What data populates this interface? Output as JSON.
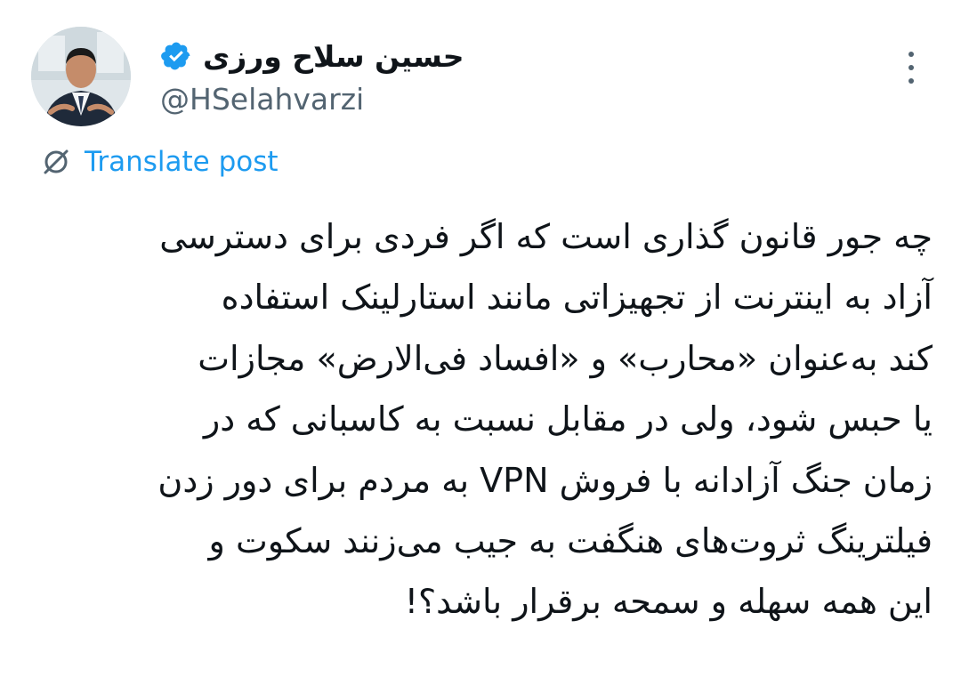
{
  "author": {
    "display_name": "حسین سلاح ورزی",
    "handle": "@HSelahvarzi",
    "verified": true,
    "avatar_icon": "profile-photo-man-in-suit"
  },
  "actions": {
    "more_icon": "more-vertical-icon",
    "translate_label": "Translate post",
    "translate_icon": "translate-globe-icon"
  },
  "post": {
    "lines": [
      "چه جور قانون گذاری است که اگر فردی برای دسترسی",
      "آزاد به اینترنت از تجهیزاتی مانند استارلینک استفاده",
      "کند به‌عنوان «محارب» و «افساد فی‌الارض» مجازات",
      "یا حبس شود، ولی در مقابل نسبت به کاسبانی که در",
      "زمان جنگ آزادانه با فروش VPN به مردم  برای دور زدن",
      "فیلترینگ ثروت‌های هنگفت به جیب می‌زنند سکوت و",
      "این همه سهله و سمحه برقرار باشد؟!"
    ]
  },
  "colors": {
    "link": "#1d9bf0",
    "verified": "#1d9bf0",
    "secondary_text": "#536471",
    "primary_text": "#0f1419"
  }
}
